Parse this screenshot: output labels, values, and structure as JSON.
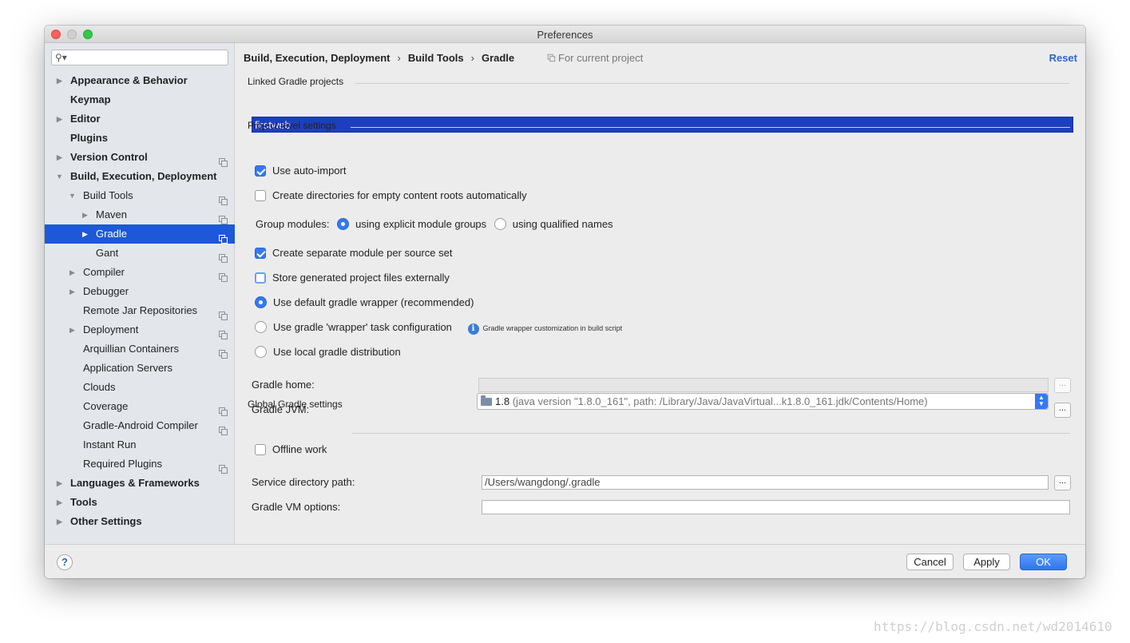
{
  "window": {
    "title": "Preferences"
  },
  "search": {
    "placeholder": ""
  },
  "sidebar": {
    "items": [
      {
        "label": "Appearance & Behavior",
        "arrow": "▶"
      },
      {
        "label": "Keymap"
      },
      {
        "label": "Editor",
        "arrow": "▶"
      },
      {
        "label": "Plugins"
      },
      {
        "label": "Version Control",
        "arrow": "▶"
      },
      {
        "label": "Build, Execution, Deployment",
        "arrow": "▼"
      },
      {
        "label": "Build Tools",
        "arrow": "▼"
      },
      {
        "label": "Maven",
        "arrow": "▶"
      },
      {
        "label": "Gradle",
        "arrow": "▶"
      },
      {
        "label": "Gant"
      },
      {
        "label": "Compiler",
        "arrow": "▶"
      },
      {
        "label": "Debugger",
        "arrow": "▶"
      },
      {
        "label": "Remote Jar Repositories"
      },
      {
        "label": "Deployment",
        "arrow": "▶"
      },
      {
        "label": "Arquillian Containers"
      },
      {
        "label": "Application Servers"
      },
      {
        "label": "Clouds"
      },
      {
        "label": "Coverage"
      },
      {
        "label": "Gradle-Android Compiler"
      },
      {
        "label": "Instant Run"
      },
      {
        "label": "Required Plugins"
      },
      {
        "label": "Languages & Frameworks",
        "arrow": "▶"
      },
      {
        "label": "Tools",
        "arrow": "▶"
      },
      {
        "label": "Other Settings",
        "arrow": "▶"
      }
    ]
  },
  "breadcrumb": {
    "parts": [
      "Build, Execution, Deployment",
      "Build Tools",
      "Gradle"
    ],
    "separator": "›",
    "scope": "For current project",
    "reset_label": "Reset"
  },
  "linked": {
    "section_label": "Linked Gradle projects",
    "projects": [
      "firstweb"
    ]
  },
  "project_settings": {
    "section_label": "Project-level settings",
    "auto_import": {
      "label": "Use auto-import",
      "checked": true
    },
    "create_dirs": {
      "label": "Create directories for empty content roots automatically",
      "checked": false
    },
    "group_modules": {
      "label": "Group modules:",
      "options": [
        "using explicit module groups",
        "using qualified names"
      ],
      "selected": "using explicit module groups"
    },
    "separate_module": {
      "label": "Create separate module per source set",
      "checked": true
    },
    "store_external": {
      "label": "Store generated project files externally",
      "checked": false
    },
    "distribution": {
      "options": [
        "Use default gradle wrapper (recommended)",
        "Use gradle 'wrapper' task configuration",
        "Use local gradle distribution"
      ],
      "selected": "Use default gradle wrapper (recommended)",
      "wrapper_hint": "Gradle wrapper customization in build script"
    },
    "gradle_home": {
      "label": "Gradle home:",
      "value": ""
    },
    "gradle_jvm": {
      "label": "Gradle JVM:",
      "version": "1.8",
      "detail": "(java version \"1.8.0_161\", path: /Library/Java/JavaVirtual...k1.8.0_161.jdk/Contents/Home)"
    },
    "browse_label": "..."
  },
  "global_settings": {
    "section_label": "Global Gradle settings",
    "offline": {
      "label": "Offline work",
      "checked": false
    },
    "service_dir": {
      "label": "Service directory path:",
      "value": "/Users/wangdong/.gradle"
    },
    "vm_options": {
      "label": "Gradle VM options:",
      "value": ""
    }
  },
  "footer": {
    "help_label": "?",
    "cancel_label": "Cancel",
    "apply_label": "Apply",
    "ok_label": "OK"
  },
  "watermark": "https://blog.csdn.net/wd2014610",
  "colors": {
    "selection": "#1d58d6",
    "accent": "#3478f6",
    "link": "#2a67c4"
  }
}
